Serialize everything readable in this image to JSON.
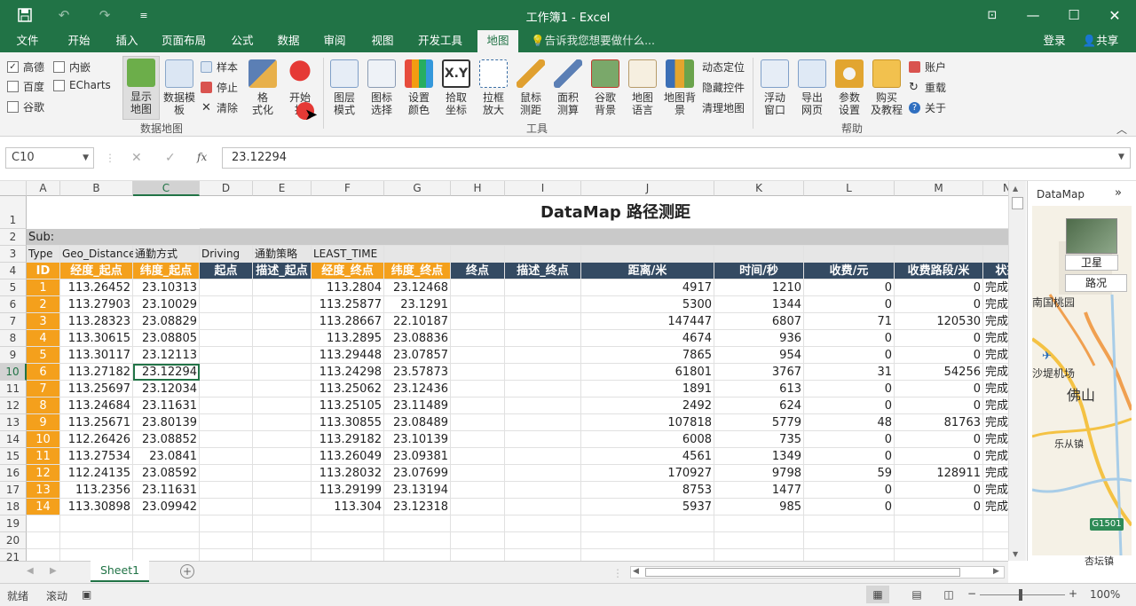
{
  "app": {
    "title": "工作簿1 - Excel"
  },
  "tabs": [
    "文件",
    "开始",
    "插入",
    "页面布局",
    "公式",
    "数据",
    "审阅",
    "视图",
    "开发工具",
    "地图"
  ],
  "tellme": "告诉我您想要做什么...",
  "account": {
    "login": "登录",
    "share": "共享"
  },
  "ribbon": {
    "checks": [
      {
        "label": "高德",
        "checked": true
      },
      {
        "label": "百度",
        "checked": false
      },
      {
        "label": "谷歌",
        "checked": false
      },
      {
        "label": "内嵌",
        "checked": false
      },
      {
        "label": "ECharts",
        "checked": false
      }
    ],
    "show_map": "显示\n地图",
    "data_template": "数据模\n板",
    "sample": "样本",
    "stop": "停止",
    "clear": "清除",
    "format": "格\n式化",
    "start": "开始\n描",
    "tools": [
      "图层\n模式",
      "图标\n选择",
      "设置\n颜色",
      "拾取\n坐标",
      "拉框\n放大",
      "鼠标\n测距",
      "面积\n测算",
      "谷歌\n背景",
      "地图\n语言",
      "地图背\n景"
    ],
    "tools_small": [
      "动态定位",
      "隐藏控件",
      "清理地图"
    ],
    "help": [
      "浮动\n窗口",
      "导出\n网页",
      "参数\n设置",
      "购买\n及教程"
    ],
    "help_small": [
      "账户",
      "重载",
      "关于"
    ],
    "groups": {
      "datamap": "数据地图",
      "tools": "工具",
      "help": "帮助"
    }
  },
  "formula_bar": {
    "namebox": "C10",
    "value": "23.12294",
    "fx": "fx"
  },
  "columns": [
    "A",
    "B",
    "C",
    "D",
    "E",
    "F",
    "G",
    "H",
    "I",
    "J",
    "K",
    "L",
    "M",
    "N"
  ],
  "title_cell": "DataMap 路径测距",
  "row2": "Sub:",
  "row3": [
    "Type",
    "Geo_Distance",
    "通勤方式",
    "Driving",
    "通勤策略",
    "LEAST_TIME"
  ],
  "headers": [
    "ID",
    "经度_起点",
    "纬度_起点",
    "起点",
    "描述_起点",
    "经度_终点",
    "纬度_终点",
    "终点",
    "描述_终点",
    "距离/米",
    "时间/秒",
    "收费/元",
    "收费路段/米",
    "状态"
  ],
  "rows": [
    [
      "1",
      "113.26452",
      "23.10313",
      "",
      "",
      "113.2804",
      "23.12468",
      "",
      "",
      "4917",
      "1210",
      "0",
      "0",
      "完成"
    ],
    [
      "2",
      "113.27903",
      "23.10029",
      "",
      "",
      "113.25877",
      "23.1291",
      "",
      "",
      "5300",
      "1344",
      "0",
      "0",
      "完成"
    ],
    [
      "3",
      "113.28323",
      "23.08829",
      "",
      "",
      "113.28667",
      "22.10187",
      "",
      "",
      "147447",
      "6807",
      "71",
      "120530",
      "完成"
    ],
    [
      "4",
      "113.30615",
      "23.08805",
      "",
      "",
      "113.2895",
      "23.08836",
      "",
      "",
      "4674",
      "936",
      "0",
      "0",
      "完成"
    ],
    [
      "5",
      "113.30117",
      "23.12113",
      "",
      "",
      "113.29448",
      "23.07857",
      "",
      "",
      "7865",
      "954",
      "0",
      "0",
      "完成"
    ],
    [
      "6",
      "113.27182",
      "23.12294",
      "",
      "",
      "113.24298",
      "23.57873",
      "",
      "",
      "61801",
      "3767",
      "31",
      "54256",
      "完成"
    ],
    [
      "7",
      "113.25697",
      "23.12034",
      "",
      "",
      "113.25062",
      "23.12436",
      "",
      "",
      "1891",
      "613",
      "0",
      "0",
      "完成"
    ],
    [
      "8",
      "113.24684",
      "23.11631",
      "",
      "",
      "113.25105",
      "23.11489",
      "",
      "",
      "2492",
      "624",
      "0",
      "0",
      "完成"
    ],
    [
      "9",
      "113.25671",
      "23.80139",
      "",
      "",
      "113.30855",
      "23.08489",
      "",
      "",
      "107818",
      "5779",
      "48",
      "81763",
      "完成"
    ],
    [
      "10",
      "112.26426",
      "23.08852",
      "",
      "",
      "113.29182",
      "23.10139",
      "",
      "",
      "6008",
      "735",
      "0",
      "0",
      "完成"
    ],
    [
      "11",
      "113.27534",
      "23.0841",
      "",
      "",
      "113.26049",
      "23.09381",
      "",
      "",
      "4561",
      "1349",
      "0",
      "0",
      "完成"
    ],
    [
      "12",
      "112.24135",
      "23.08592",
      "",
      "",
      "113.28032",
      "23.07699",
      "",
      "",
      "170927",
      "9798",
      "59",
      "128911",
      "完成"
    ],
    [
      "13",
      "113.2356",
      "23.11631",
      "",
      "",
      "113.29199",
      "23.13194",
      "",
      "",
      "8753",
      "1477",
      "0",
      "0",
      "完成"
    ],
    [
      "14",
      "113.30898",
      "23.09942",
      "",
      "",
      "113.304",
      "23.12318",
      "",
      "",
      "5937",
      "985",
      "0",
      "0",
      "完成"
    ]
  ],
  "row_numbers": [
    "1",
    "2",
    "3",
    "4",
    "5",
    "6",
    "7",
    "8",
    "9",
    "10",
    "11",
    "12",
    "13",
    "14",
    "15",
    "16",
    "17",
    "18",
    "19",
    "20",
    "21"
  ],
  "panel": {
    "title": "DataMap",
    "satellite": "卫星",
    "road": "路况",
    "places": [
      "南国桃园",
      "沙堤机场",
      "佛山",
      "乐从镇",
      "杏坛镇"
    ],
    "road_sign": "G1501"
  },
  "sheet_tab": "Sheet1",
  "status": {
    "ready": "就绪",
    "scroll": "滚动",
    "zoom": "100%"
  }
}
